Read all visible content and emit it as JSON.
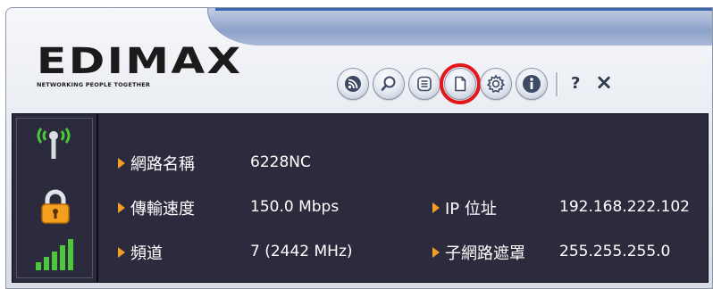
{
  "app": {
    "logo_text": "EDIMAX",
    "logo_tagline": "NETWORKING PEOPLE TOGETHER"
  },
  "toolbar": {
    "buttons": [
      {
        "icon": "rss-icon"
      },
      {
        "icon": "search-icon"
      },
      {
        "icon": "list-icon"
      },
      {
        "icon": "document-icon",
        "highlighted": true
      },
      {
        "icon": "gear-icon"
      },
      {
        "icon": "info-icon"
      }
    ],
    "help_label": "?",
    "close_label": "×",
    "highlight_color": "#e3161b"
  },
  "status_icons": [
    "signal-antenna-icon",
    "lock-icon",
    "signal-strength-icon"
  ],
  "status": {
    "network_name_label": "網路名稱",
    "network_name_value": "6228NC",
    "speed_label": "傳輸速度",
    "speed_value": "150.0 Mbps",
    "channel_label": "頻道",
    "channel_value": "7 (2442 MHz)",
    "ip_label": "IP 位址",
    "ip_value": "192.168.222.102",
    "subnet_label": "子網路遮罩",
    "subnet_value": "255.255.255.0"
  },
  "colors": {
    "panel_bg": "#2b2b3d",
    "bullet": "#f3a021",
    "signal_green": "#4cc63a",
    "lock_orange": "#f3a021",
    "logo_dot": "#d8141d"
  }
}
